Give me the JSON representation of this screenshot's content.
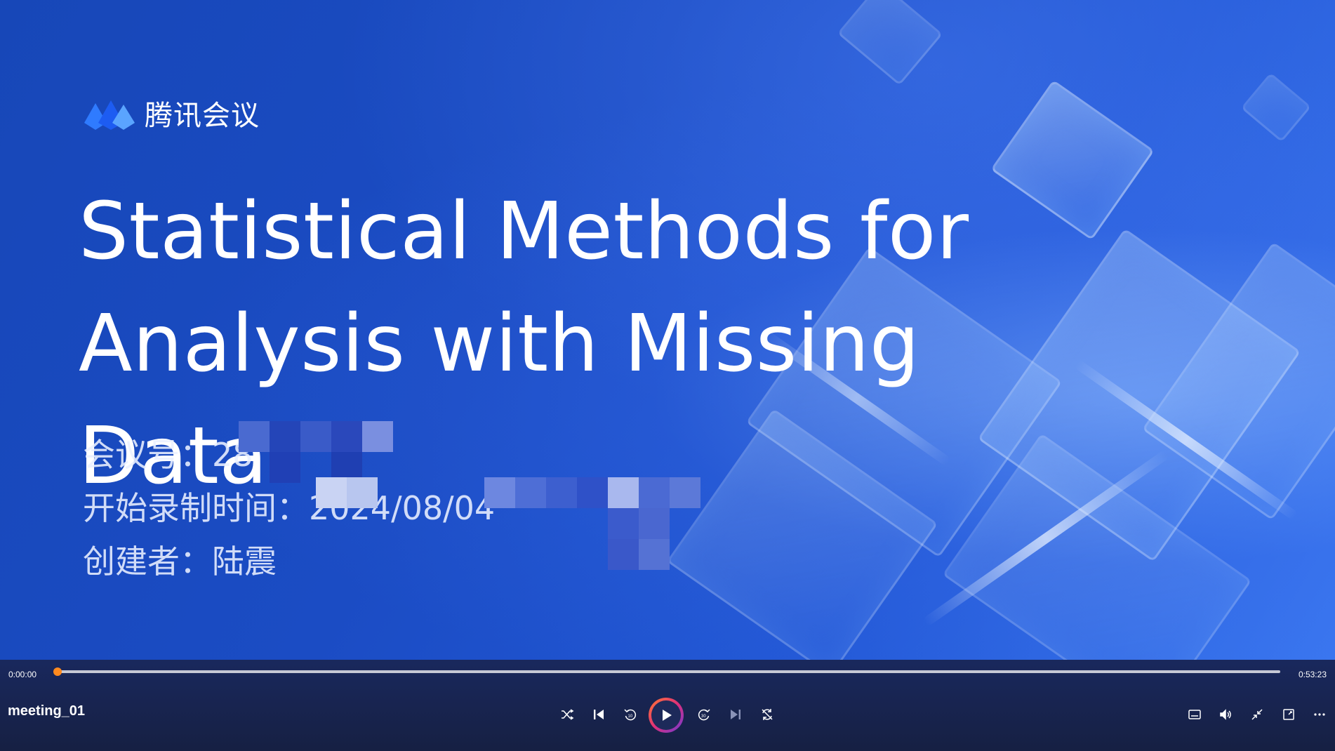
{
  "slide": {
    "logo_text": "腾讯会议",
    "title_line1": "Statistical Methods for",
    "title_line2": "Analysis with Missing Data",
    "meeting_id": "会议号：28",
    "record_start": "开始录制时间：2024/08/04",
    "creator": "创建者：陆震"
  },
  "player": {
    "current_time": "0:00:00",
    "total_time": "0:53:23",
    "progress": 0.0,
    "file_name": "meeting_01",
    "controls": [
      "shuffle-icon",
      "previous-icon",
      "rewind-10-icon",
      "play-icon",
      "forward-30-icon",
      "next-icon",
      "repeat-off-icon"
    ],
    "right_controls": [
      "subtitles-icon",
      "volume-icon",
      "exit-fullscreen-icon",
      "mini-player-icon",
      "more-icon"
    ],
    "accent": "#ff8a1f"
  }
}
